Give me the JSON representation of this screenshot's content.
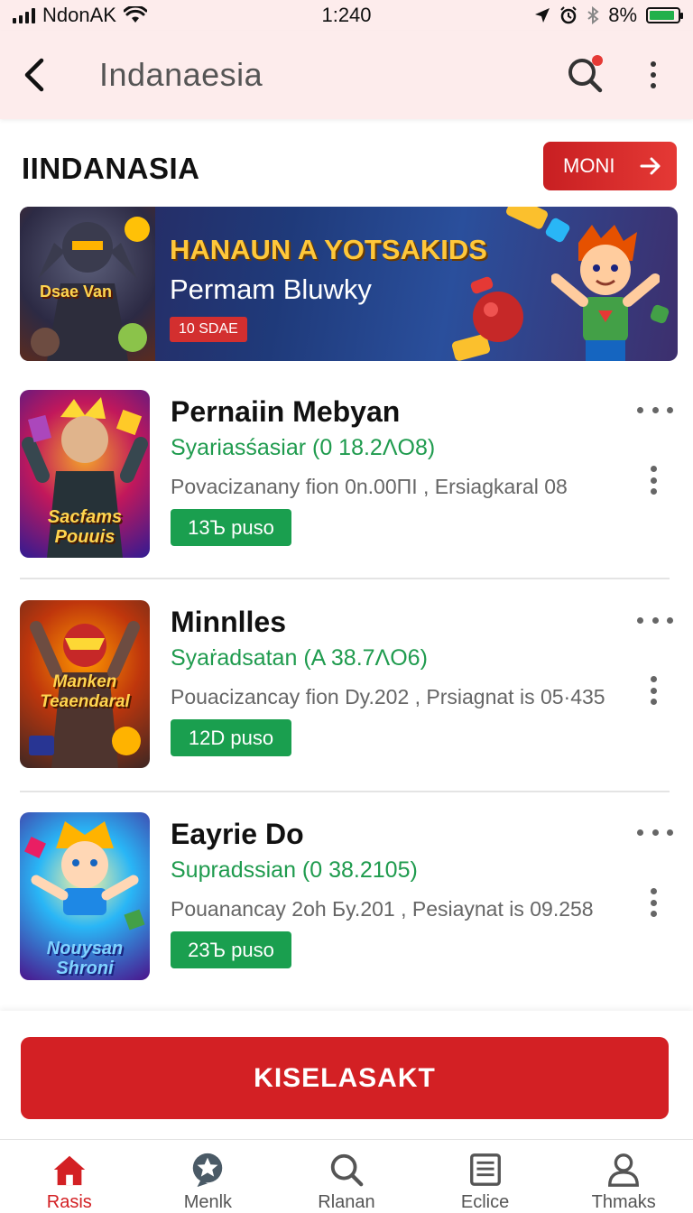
{
  "status_bar": {
    "carrier": "NdonAK",
    "time": "1:240",
    "battery_text": "8%",
    "battery_level": 0.9
  },
  "app_bar": {
    "title": "Indanaesia",
    "back_icon": "arrow-left-icon",
    "search_icon": "search-icon",
    "more_icon": "more-vertical-icon"
  },
  "section": {
    "title": "IINDANASIA",
    "more_label": "MONI"
  },
  "banner": {
    "hero_label": "Dsae Van",
    "title": "HANAUN A YOTSAKIDS",
    "subtitle": "Permam Bluwky",
    "badge": "10 SDAE"
  },
  "games": [
    {
      "thumb_label": "Sacfams Pouuis",
      "name": "Pernaiin Mebyan",
      "stat": "Syariasśasiar (0 18.2ɅO8)",
      "meta": "Povacizanany fion 0n.00ΠΙ , Ersiagkaral 08",
      "price": "13Ъ puso"
    },
    {
      "thumb_label": "Manken Teaendaral",
      "name": "Minnlles",
      "stat": "Syaṙadsatan (A 38.7ɅO6)",
      "meta": "Pouacizancay fion Dy.202 , Prsiagnat is 05·435",
      "price": "12D puso"
    },
    {
      "thumb_label": "Nouysan Shroni",
      "name": "Eayrie Do",
      "stat": "Supradssian (0 38.2105)",
      "meta": "Pouanancay 2oh Бy.201 , Pesiaynat is 09.258",
      "price": "23Ъ puso"
    }
  ],
  "cta": {
    "label": "KISELASAKT"
  },
  "bottom_nav": [
    {
      "label": "Rasis",
      "icon": "home-icon",
      "active": true
    },
    {
      "label": "Menlk",
      "icon": "star-badge-icon",
      "active": false
    },
    {
      "label": "Rlanan",
      "icon": "search-icon",
      "active": false
    },
    {
      "label": "Eclice",
      "icon": "list-icon",
      "active": false
    },
    {
      "label": "Thmaks",
      "icon": "user-icon",
      "active": false
    }
  ],
  "colors": {
    "accent": "#d32024",
    "green": "#1a9f4f",
    "header_bg": "#fdecec"
  }
}
